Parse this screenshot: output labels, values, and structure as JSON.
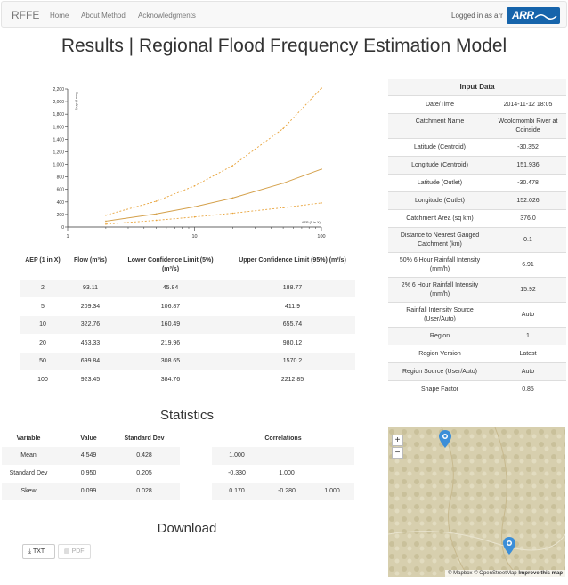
{
  "nav": {
    "brand": "RFFE",
    "links": [
      "Home",
      "About Method",
      "Acknowledgments"
    ],
    "logged_in": "Logged in as arr",
    "logo_text": "ARR"
  },
  "page_title": "Results | Regional Flood Frequency Estimation Model",
  "chart_data": {
    "type": "line",
    "xscale": "log",
    "xlim": [
      1,
      100
    ],
    "ylim": [
      0,
      2200
    ],
    "xticks": [
      "1",
      "10",
      "100"
    ],
    "yticks": [
      "0",
      "200",
      "400",
      "600",
      "800",
      "1,000",
      "1,200",
      "1,400",
      "1,600",
      "1,800",
      "2,000",
      "2,200"
    ],
    "ylabel": "Flow (m3/s)",
    "xlabel": "AEP (1 in X)",
    "series": [
      {
        "name": "",
        "style": "solid",
        "color": "#d4a04a",
        "x": [
          2,
          5,
          10,
          20,
          50,
          100
        ],
        "y": [
          93.11,
          209.34,
          322.76,
          463.33,
          699.84,
          923.45
        ]
      },
      {
        "name": "",
        "style": "dotted",
        "color": "#e8a33a",
        "x": [
          2,
          5,
          10,
          20,
          50,
          100
        ],
        "y": [
          45.84,
          106.87,
          160.49,
          219.96,
          308.65,
          384.76
        ]
      },
      {
        "name": "",
        "style": "dotted",
        "color": "#e8a33a",
        "x": [
          2,
          5,
          10,
          20,
          50,
          100
        ],
        "y": [
          188.77,
          411.9,
          655.74,
          980.12,
          1570.2,
          2212.85
        ]
      }
    ]
  },
  "results_table": {
    "headers": {
      "aep": "AEP (1 in X)",
      "flow": "Flow (m³/s)",
      "lower": "Lower Confidence Limit (5%) (m³/s)",
      "upper": "Upper Confidence Limit (95%) (m³/s)"
    },
    "rows": [
      [
        "2",
        "93.11",
        "45.84",
        "188.77"
      ],
      [
        "5",
        "209.34",
        "106.87",
        "411.9"
      ],
      [
        "10",
        "322.76",
        "160.49",
        "655.74"
      ],
      [
        "20",
        "463.33",
        "219.96",
        "980.12"
      ],
      [
        "50",
        "699.84",
        "308.65",
        "1570.2"
      ],
      [
        "100",
        "923.45",
        "384.76",
        "2212.85"
      ]
    ]
  },
  "input_data": {
    "title": "Input Data",
    "rows": [
      [
        "Date/Time",
        "2014-11-12 18:05"
      ],
      [
        "Catchment Name",
        "Woolomombi River at Coinside"
      ],
      [
        "Latitude (Centroid)",
        "-30.352"
      ],
      [
        "Longitude (Centroid)",
        "151.936"
      ],
      [
        "Latitude (Outlet)",
        "-30.478"
      ],
      [
        "Longitude (Outlet)",
        "152.026"
      ],
      [
        "Catchment Area (sq km)",
        "376.0"
      ],
      [
        "Distance to Nearest Gauged Catchment (km)",
        "0.1"
      ],
      [
        "50% 6 Hour Rainfall Intensity (mm/h)",
        "6.91"
      ],
      [
        "2% 6 Hour Rainfall Intensity (mm/h)",
        "15.92"
      ],
      [
        "Rainfall Intensity Source (User/Auto)",
        "Auto"
      ],
      [
        "Region",
        "1"
      ],
      [
        "Region Version",
        "Latest"
      ],
      [
        "Region Source (User/Auto)",
        "Auto"
      ],
      [
        "Shape Factor",
        "0.85"
      ]
    ]
  },
  "statistics": {
    "title": "Statistics",
    "headers": [
      "Variable",
      "Value",
      "Standard Dev"
    ],
    "rows": [
      [
        "Mean",
        "4.549",
        "0.428"
      ],
      [
        "Standard Dev",
        "0.950",
        "0.205"
      ],
      [
        "Skew",
        "0.099",
        "0.028"
      ]
    ],
    "correlations_title": "Correlations",
    "correlations": [
      [
        "1.000",
        "",
        ""
      ],
      [
        "-0.330",
        "1.000",
        ""
      ],
      [
        "0.170",
        "-0.280",
        "1.000"
      ]
    ]
  },
  "download": {
    "title": "Download",
    "txt_label": "TXT",
    "pdf_label": "PDF"
  },
  "map": {
    "zoom_in": "+",
    "zoom_out": "−",
    "attribution_1": "© Mapbox © OpenStreetMap ",
    "attribution_2": "Improve this map"
  }
}
